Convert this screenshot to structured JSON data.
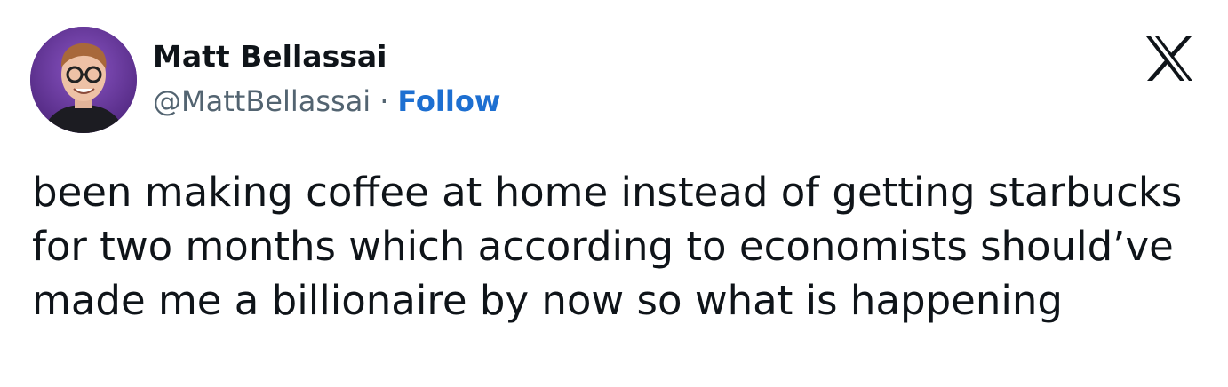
{
  "author": {
    "display_name": "Matt Bellassai",
    "handle": "@MattBellassai",
    "separator": "·",
    "follow_label": "Follow",
    "avatar_icon": "profile-photo-icon"
  },
  "platform": {
    "logo_icon": "x-logo-icon"
  },
  "tweet": {
    "text": "been making coffee at home instead of getting starbucks for two months which according to economists should’ve made me a billionaire by now so what is happening"
  },
  "colors": {
    "follow": "#1d6fd1",
    "handle": "#536471",
    "text": "#0f1419",
    "avatar_bg": "#6a3aa0"
  }
}
